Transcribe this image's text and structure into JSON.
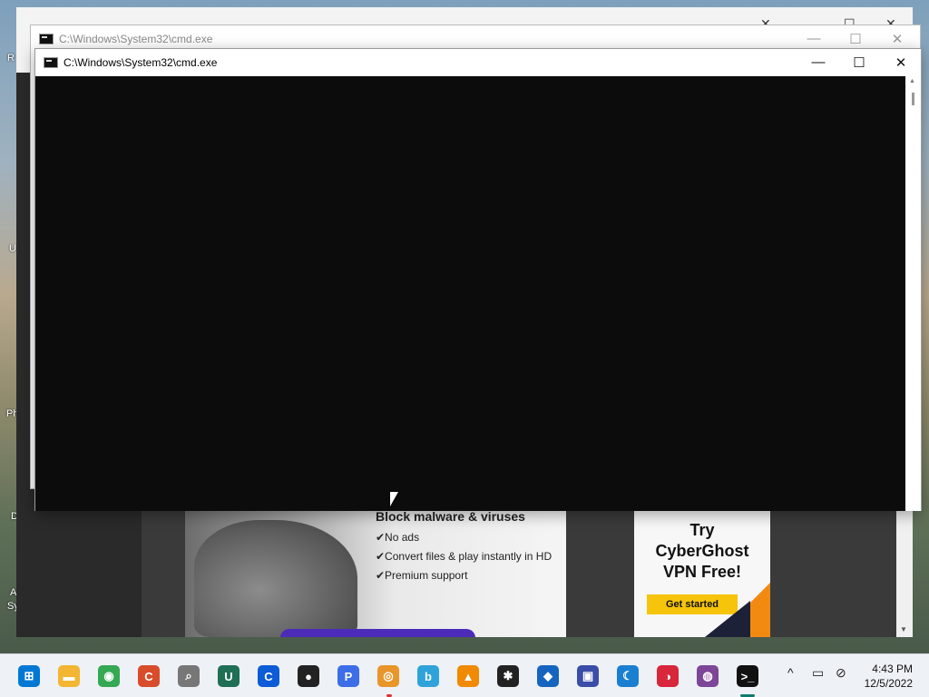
{
  "windows": {
    "back_cmd": {
      "title": "C:\\Windows\\System32\\cmd.exe"
    },
    "front_cmd": {
      "title": "C:\\Windows\\System32\\cmd.exe"
    }
  },
  "controls": {
    "minimize": "—",
    "maximize": "☐",
    "close": "✕"
  },
  "ads": {
    "malware_ad": {
      "headline": "Block malware & viruses",
      "features": [
        "✔No ads",
        "✔Convert files & play instantly in HD",
        "✔Premium support"
      ]
    },
    "vpn_ad": {
      "line1": "Try",
      "line2": "CyberGhost",
      "line3": "VPN Free!",
      "button": "Get started"
    }
  },
  "desktop_letters": [
    "R",
    "U",
    "Ph",
    "D",
    "A",
    "Sy"
  ],
  "taskbar": {
    "icons": [
      {
        "name": "start-icon",
        "glyph": "⊞",
        "color": "#0078d4"
      },
      {
        "name": "file-explorer-icon",
        "glyph": "▬",
        "color": "#f2b632"
      },
      {
        "name": "chrome-icon",
        "glyph": "◉",
        "color": "#34a853"
      },
      {
        "name": "ccleaner-icon",
        "glyph": "C",
        "color": "#d94c2b"
      },
      {
        "name": "search-tool-icon",
        "glyph": "⌕",
        "color": "#777777"
      },
      {
        "name": "u-app-icon",
        "glyph": "U",
        "color": "#1f6f54"
      },
      {
        "name": "c-app-icon",
        "glyph": "C",
        "color": "#0b5cd6"
      },
      {
        "name": "screen-recorder-icon",
        "glyph": "●",
        "color": "#222222"
      },
      {
        "name": "p-app-icon",
        "glyph": "P",
        "color": "#3d6ee8"
      },
      {
        "name": "browser-icon",
        "glyph": "◎",
        "color": "#e8962a"
      },
      {
        "name": "bing-icon",
        "glyph": "b",
        "color": "#2fa3d9"
      },
      {
        "name": "vlc-icon",
        "glyph": "▲",
        "color": "#f08a00"
      },
      {
        "name": "antivirus-icon",
        "glyph": "✱",
        "color": "#222222"
      },
      {
        "name": "cube-app-icon",
        "glyph": "◆",
        "color": "#1565c0"
      },
      {
        "name": "control-panel-icon",
        "glyph": "▣",
        "color": "#3a4ea8"
      },
      {
        "name": "moon-app-icon",
        "glyph": "☾",
        "color": "#1b7fd1"
      },
      {
        "name": "red-app-icon",
        "glyph": "◑",
        "color": "#d8263a"
      },
      {
        "name": "tor-icon",
        "glyph": "◍",
        "color": "#7d4698"
      },
      {
        "name": "cmd-taskbar-icon",
        "glyph": ">_",
        "color": "#111111"
      }
    ],
    "tray": {
      "chevron": "^",
      "network": "▭",
      "volume": "⊘"
    },
    "time": "4:43 PM",
    "date": "12/5/2022"
  }
}
